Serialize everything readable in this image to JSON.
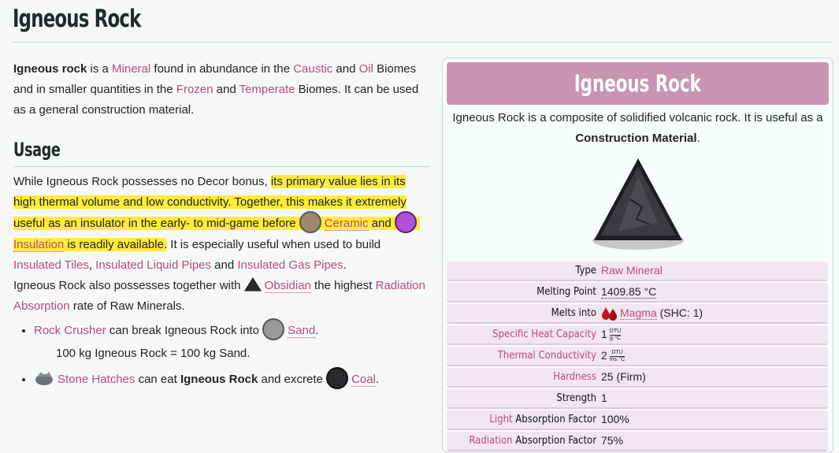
{
  "page": {
    "title": "Igneous Rock"
  },
  "intro": {
    "b1": "Igneous rock",
    "t1": " is a ",
    "l_mineral": "Mineral",
    "t2": " found in abundance in the ",
    "l_caustic": "Caustic",
    "t3": " and ",
    "l_oil": "Oil",
    "t4": " Biomes and in smaller quantities in the ",
    "l_frozen": "Frozen",
    "t5": " and ",
    "l_temperate": "Temperate",
    "t6": " Biomes. It can be used as a general construction material."
  },
  "usage": {
    "heading": "Usage",
    "p1a": "While Igneous Rock possesses no Decor bonus, ",
    "p1_hl": "its primary value lies in its high thermal volume and low conductivity. Together, this makes it extremely useful as an insulator in the early- to mid-game before ",
    "l_ceramic": "Ceramic",
    "and1": " and ",
    "l_insulation": "Insulation",
    "hl_end": " is readily available.",
    "p1b": " It is especially useful when used to build ",
    "l_tiles": "Insulated Tiles",
    "comma": ", ",
    "l_liquid": "Insulated Liquid Pipes",
    "and2": " and ",
    "l_gas": "Insulated Gas Pipes",
    "period": ".",
    "p2a": "Igneous Rock also possesses together with ",
    "l_obsidian": "Obsidian",
    "p2b": " the highest ",
    "l_radabs": "Radiation Absorption",
    "p2c": " rate of Raw Minerals.",
    "li1_link": "Rock Crusher",
    "li1_text": " can break Igneous Rock into ",
    "li1_sand": "Sand",
    "li1_end": ".",
    "li1_sub": "100 kg Igneous Rock = 100 kg Sand.",
    "li2_link": "Stone Hatches",
    "li2_text": " can eat ",
    "li2_bold": "Igneous Rock",
    "li2_text2": " and excrete ",
    "li2_coal": "Coal",
    "li2_end": "."
  },
  "infobox": {
    "title": "Igneous Rock",
    "desc": "Igneous Rock is a composite of solidified volcanic rock. It is useful as a ",
    "desc_bold": "Construction Material",
    "desc_end": ".",
    "rows": {
      "type_k": "Type",
      "type_v": "Raw Mineral",
      "melt_k": "Melting Point",
      "melt_v": "1409.85 °C",
      "into_k": "Melts into",
      "into_v": "Magma",
      "into_extra": " (SHC: 1)",
      "shc_k": "Specific Heat Capacity",
      "shc_v": "1",
      "shc_num": "DTU",
      "shc_den": "g·°C",
      "tc_k": "Thermal Conductivity",
      "tc_v": "2",
      "tc_num": "DTU",
      "tc_den": "ms·°C",
      "hard_k": "Hardness",
      "hard_v": "25 (Firm)",
      "str_k": "Strength",
      "str_v": "1",
      "light_k1": "Light",
      "light_k2": " Absorption Factor",
      "light_v": "100%",
      "rad_k1": "Radiation",
      "rad_k2": " Absorption Factor",
      "rad_v": "75%"
    }
  },
  "colors": {
    "link": "#b8497b",
    "highlight": "#ffeb3b",
    "infobox_title": "#c993b4"
  }
}
